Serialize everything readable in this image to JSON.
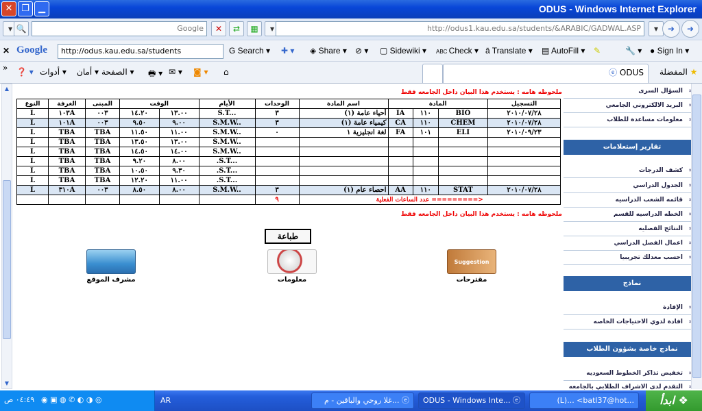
{
  "window": {
    "title": "ODUS - Windows Internet Explorer"
  },
  "address": {
    "url": "http://odus1.kau.edu.sa/students/&ARABIC/GADWAL.ASP",
    "search_placeholder": "Google"
  },
  "google_toolbar": {
    "logo": "Google",
    "url": "http://odus.kau.edu.sa/students",
    "search": "Search",
    "share": "Share",
    "sidewiki": "Sidewiki",
    "check": "Check",
    "translate": "Translate",
    "autofill": "AutoFill",
    "signin": "Sign In"
  },
  "nav": {
    "favorites": "المفضلة",
    "tab_title": "ODUS",
    "page_menu": "الصفحة",
    "safety_menu": "أمان",
    "tools_menu": "أدوات"
  },
  "notice": "ملحوظه هامه : يستخدم هذا البيان داخل الجامعه فقط",
  "table": {
    "headers": [
      "التسجيل",
      "المادة",
      "اسم المادة",
      "الوحدات",
      "الأيام",
      "الوقت",
      "المبنى",
      "الغرفة",
      "النوع"
    ],
    "rows": [
      {
        "reg": "٢٠١٠/٠٧/٢٨",
        "dept": "BIO",
        "num": "١١٠",
        "sec": "IA",
        "name": "أحياء عامة (١)",
        "units": "٣",
        "days": "S.T...",
        "from": "١٣.٠٠",
        "to": "١٤.٢٠",
        "bldg": "٠٠٣",
        "room": "١٠٣A",
        "type": "L",
        "style": "white"
      },
      {
        "reg": "٢٠١٠/٠٧/٢٨",
        "dept": "CHEM",
        "num": "١١٠",
        "sec": "CA",
        "name": "كيمياء عامة (١)",
        "units": "٣",
        "days": "S.M.W..",
        "from": "٩.٠٠",
        "to": "٩.٥٠",
        "bldg": "٠٠٣",
        "room": "١٠١A",
        "type": "L",
        "style": "blue"
      },
      {
        "reg": "٢٠١٠/٠٩/٢٣",
        "dept": "ELI",
        "num": "١٠١",
        "sec": "FA",
        "name": "لغة انجليزية ١",
        "units": "٠",
        "days": "S.M.W..",
        "from": "١١.٠٠",
        "to": "١١.٥٠",
        "bldg": "TBA",
        "room": "TBA",
        "type": "L",
        "style": "white"
      },
      {
        "reg": "",
        "dept": "",
        "num": "",
        "sec": "",
        "name": "",
        "units": "",
        "days": "S.M.W..",
        "from": "١٣.٠٠",
        "to": "١٣.٥٠",
        "bldg": "TBA",
        "room": "TBA",
        "type": "L",
        "style": "white"
      },
      {
        "reg": "",
        "dept": "",
        "num": "",
        "sec": "",
        "name": "",
        "units": "",
        "days": "S.M.W..",
        "from": "١٤.٠٠",
        "to": "١٤.٥٠",
        "bldg": "TBA",
        "room": "TBA",
        "type": "L",
        "style": "white"
      },
      {
        "reg": "",
        "dept": "",
        "num": "",
        "sec": "",
        "name": "",
        "units": "",
        "days": ".S.T...",
        "from": "٨.٠٠",
        "to": "٩.٢٠",
        "bldg": "TBA",
        "room": "TBA",
        "type": "L",
        "style": "white"
      },
      {
        "reg": "",
        "dept": "",
        "num": "",
        "sec": "",
        "name": "",
        "units": "",
        "days": ".S.T...",
        "from": "٩.٣٠",
        "to": "١٠.٥٠",
        "bldg": "TBA",
        "room": "TBA",
        "type": "L",
        "style": "white"
      },
      {
        "reg": "",
        "dept": "",
        "num": "",
        "sec": "",
        "name": "",
        "units": "",
        "days": ".S.T...",
        "from": "١١.٠٠",
        "to": "١٢.٢٠",
        "bldg": "TBA",
        "room": "TBA",
        "type": "L",
        "style": "white"
      },
      {
        "reg": "٢٠١٠/٠٧/٢٨",
        "dept": "STAT",
        "num": "١١٠",
        "sec": "AA",
        "name": "احصاء عام (١)",
        "units": "٣",
        "days": "S.M.W..",
        "from": "٨.٠٠",
        "to": "٨.٥٠",
        "bldg": "٠٠٣",
        "room": "٣١٠A",
        "type": "L",
        "style": "blue"
      }
    ],
    "total_label": "عدد الساعات الفعلية =========>",
    "total_value": "٩"
  },
  "print_button": "طباعة",
  "icons": {
    "site_admin": "مشرف الموقع",
    "info": "معلومات",
    "suggestions": "مقترحات",
    "suggestion_box_text": "Suggestion box"
  },
  "sidebar": {
    "links_top": [
      "السؤال السرى",
      "البريد الالكتروني الجامعي",
      "معلومات مساعدة للطلاب"
    ],
    "head_reports": "تقارير إستعلامات",
    "links_reports": [
      "كشف الدرجات",
      "الجدول الدراسي",
      "قائمه الشعب الدراسيه",
      "الخطه الدراسيه للقسم",
      "النتائج الفصليه",
      "اعمال الفصل الدراسي",
      "احسب معدلك تجريبيا"
    ],
    "head_forms": "نماذج",
    "links_forms": [
      "الإفادة",
      "افادة لذوي الاحتياجات الخاصه"
    ],
    "head_student_forms": "نماذج خاصة بشؤون الطلاب",
    "links_student_forms": [
      "تخفيض تذاكر الخطوط السعوديه",
      "التقدم لدى الاشراف الطلابي بالجامعه"
    ]
  },
  "taskbar": {
    "start": "ابدأ",
    "items": [
      "(L)... <batl37@hot...",
      "ODUS - Windows Inte...",
      "غلا روحي والباقين - م..."
    ],
    "lang": "AR",
    "clock": "٠٤:٤٩ ص"
  }
}
